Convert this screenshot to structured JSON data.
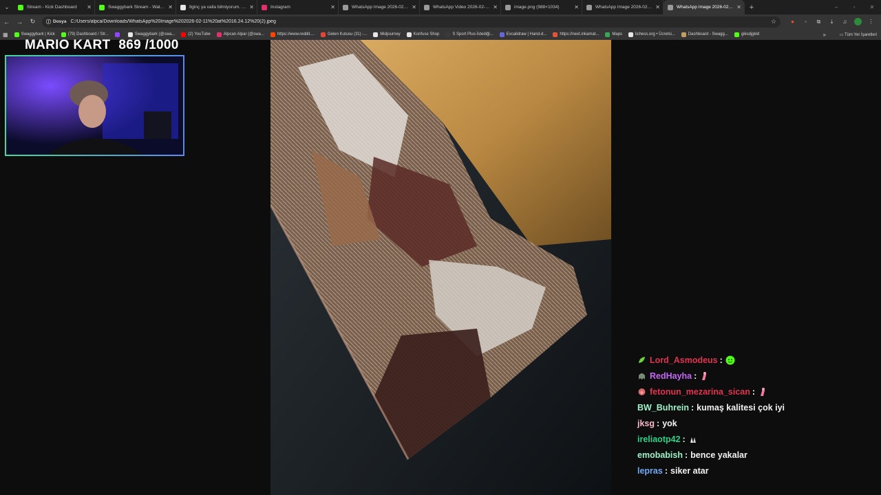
{
  "browser": {
    "tabs": [
      {
        "title": "Stream - Kick Dashboard",
        "favicon_color": "#53fc18",
        "active": false
      },
      {
        "title": "Swaggybark Stream - Watch Li...",
        "favicon_color": "#53fc18",
        "active": false
      },
      {
        "title": "İlginç ya valla bilmiyorum. Bazı...",
        "favicon_color": "#e6e6e6",
        "active": false
      },
      {
        "title": "Instagram",
        "favicon_color": "#e1306c",
        "active": false
      },
      {
        "title": "WhatsApp Image 2026-02-11 a...",
        "favicon_color": "#9a9a9a",
        "active": false
      },
      {
        "title": "WhatsApp Video 2026-02-11 a...",
        "favicon_color": "#9a9a9a",
        "active": false
      },
      {
        "title": "image.png (988×1034)",
        "favicon_color": "#9a9a9a",
        "active": false
      },
      {
        "title": "WhatsApp Image 2026-02-11 a...",
        "favicon_color": "#9a9a9a",
        "active": false
      },
      {
        "title": "WhatsApp Image 2026-02-11 a...",
        "favicon_color": "#9a9a9a",
        "active": true
      }
    ],
    "address": {
      "chip_label": "Dosya",
      "url": "C:/Users/alpca/Downloads/WhatsApp%20Image%202026-02-11%20at%2016.24.12%20(2).jpeg"
    },
    "bookmarks": [
      {
        "label": "Swaggybark | Kick",
        "color": "#53fc18"
      },
      {
        "label": "(79) Dashboard / Str...",
        "color": "#53fc18"
      },
      {
        "label": "",
        "color": "#9146ff"
      },
      {
        "label": "Swaggybark (@swa...",
        "color": "#e6e6e6"
      },
      {
        "label": "(2) YouTube",
        "color": "#ff0000"
      },
      {
        "label": "Alpcan Alpar (@swa...",
        "color": "#e1306c"
      },
      {
        "label": "https://www.reddit....",
        "color": "#ff4500"
      },
      {
        "label": "Gelen Kutusu (31) -...",
        "color": "#ea4335"
      },
      {
        "label": "Midjourney",
        "color": "#e6e6e6"
      },
      {
        "label": "Konfuse Shop",
        "color": "#e6e6e6"
      },
      {
        "label": "S Sport Plus-İstediği...",
        "color": "#3a3a3a"
      },
      {
        "label": "Excalidraw | Hand-d...",
        "color": "#6965db"
      },
      {
        "label": "https://next.inkamat...",
        "color": "#e0553a"
      },
      {
        "label": "Maps",
        "color": "#34a853"
      },
      {
        "label": "lichess.org • Ücretsi...",
        "color": "#e6e6e6"
      },
      {
        "label": "Dashboard - Swagg...",
        "color": "#c0a060"
      },
      {
        "label": "giksdjgkld",
        "color": "#53fc18"
      }
    ],
    "all_bookmarks_label": "Tüm Yer İşaretleri"
  },
  "overlay": {
    "title": "MARIO KART",
    "count": "869 /1000"
  },
  "chat": {
    "messages": [
      {
        "user": "Lord_Asmodeus",
        "user_color": "#e0334f",
        "badge": "leaf-badge",
        "text": "",
        "emote": "green-face-emote"
      },
      {
        "user": "RedHayha",
        "user_color": "#c466f5",
        "badge": "ghost-badge",
        "text": "",
        "emote": "pink-figure-emote"
      },
      {
        "user": "fetonun_mezarina_sican",
        "user_color": "#e0334f",
        "badge": "pig-badge",
        "text": "",
        "emote": "pink-figure-emote"
      },
      {
        "user": "BW_Buhrein",
        "user_color": "#9ef0c8",
        "badge": "",
        "text": "kumaş kalitesi çok iyi",
        "emote": ""
      },
      {
        "user": "jksg",
        "user_color": "#f5b9c9",
        "badge": "",
        "text": "yok",
        "emote": ""
      },
      {
        "user": "ireliaotp42",
        "user_color": "#2fd18a",
        "badge": "",
        "text": "",
        "emote": "hands-emote"
      },
      {
        "user": "emobabish",
        "user_color": "#9ef0c8",
        "badge": "",
        "text": "bence yakalar",
        "emote": ""
      },
      {
        "user": "lepras",
        "user_color": "#6fa8f5",
        "badge": "",
        "text": "siker atar",
        "emote": ""
      }
    ]
  }
}
